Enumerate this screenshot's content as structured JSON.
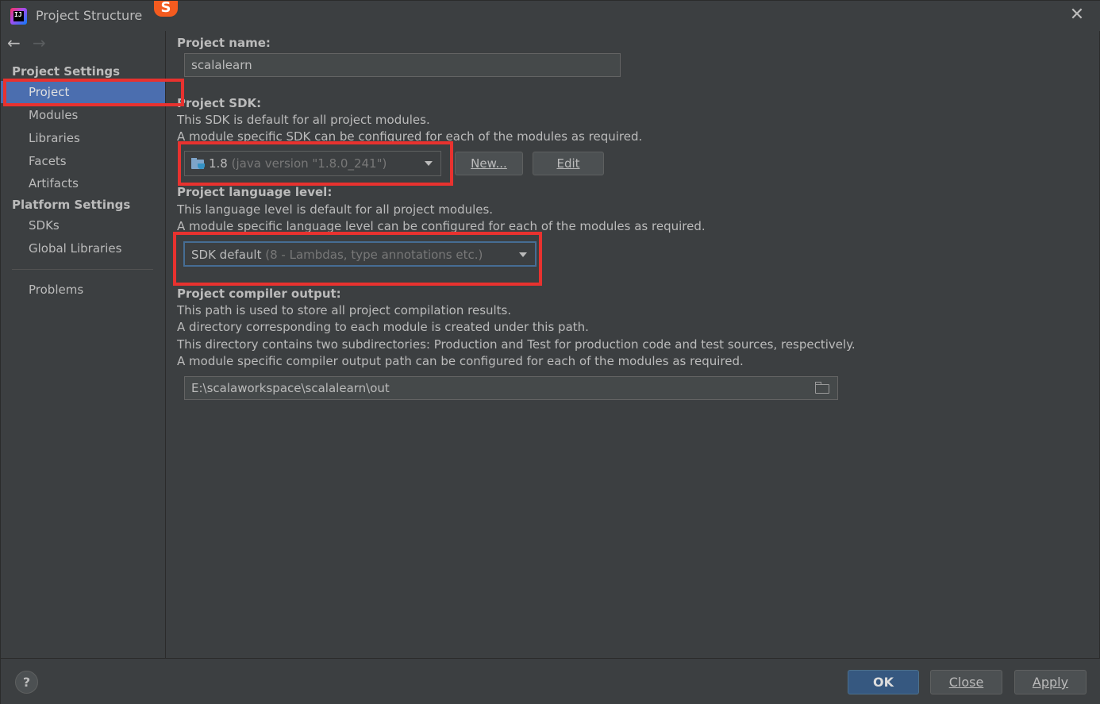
{
  "window": {
    "title": "Project Structure",
    "close_glyph": "✕",
    "ime_glyph": "S"
  },
  "sidebar": {
    "back_glyph": "←",
    "forward_glyph": "→",
    "project_settings_header": "Project Settings",
    "project_settings_items": [
      "Project",
      "Modules",
      "Libraries",
      "Facets",
      "Artifacts"
    ],
    "selected_item": "Project",
    "platform_settings_header": "Platform Settings",
    "platform_settings_items": [
      "SDKs",
      "Global Libraries"
    ],
    "problems_label": "Problems"
  },
  "project_name": {
    "label": "Project name:",
    "value": "scalalearn"
  },
  "project_sdk": {
    "label": "Project SDK:",
    "desc_line1": "This SDK is default for all project modules.",
    "desc_line2": "A module specific SDK can be configured for each of the modules as required.",
    "selected_version": "1.8",
    "selected_detail": "(java version \"1.8.0_241\")",
    "new_button": "New...",
    "edit_button": "Edit",
    "icon": "jdk-folder-icon"
  },
  "language_level": {
    "label": "Project language level:",
    "desc_line1": "This language level is default for all project modules.",
    "desc_line2": "A module specific language level can be configured for each of the modules as required.",
    "selected_value": "SDK default",
    "selected_detail": "(8 - Lambdas, type annotations etc.)"
  },
  "compiler_output": {
    "label": "Project compiler output:",
    "desc_line1": "This path is used to store all project compilation results.",
    "desc_line2": "A directory corresponding to each module is created under this path.",
    "desc_line3": "This directory contains two subdirectories: Production and Test for production code and test sources, respectively.",
    "desc_line4": "A module specific compiler output path can be configured for each of the modules as required.",
    "path": "E:\\scalaworkspace\\scalalearn\\out",
    "icon": "folder-open-icon"
  },
  "footer": {
    "help_label": "?",
    "ok_label": "OK",
    "close_label": "Close",
    "apply_label": "Apply"
  },
  "colors": {
    "background": "#3c3f41",
    "selection": "#4b6eaf",
    "primary_button": "#365880",
    "annotation_red": "#e8322f"
  }
}
